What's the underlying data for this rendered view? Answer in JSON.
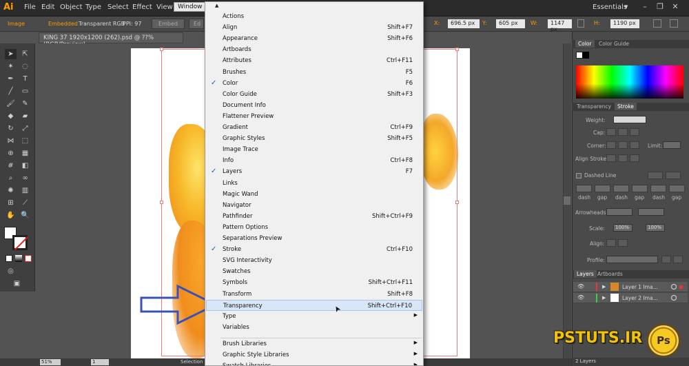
{
  "menubar": {
    "logo": "Ai",
    "items": [
      "File",
      "Edit",
      "Object",
      "Type",
      "Select",
      "Effect",
      "View",
      "Window"
    ],
    "workspace": "Essentials"
  },
  "controlbar": {
    "object_type": "Image",
    "embedded": "Embedded",
    "color_mode": "Transparent RGB",
    "ppi": "PPI: 97",
    "embed_button": "Embed",
    "edit_button": "Ed",
    "x_label": "X:",
    "x_value": "696.5 px",
    "y_label": "Y:",
    "y_value": "605 px",
    "w_label": "W:",
    "w_value": "1147 px",
    "h_label": "H:",
    "h_value": "1190 px"
  },
  "document": {
    "tab_title": "KING 37 1920x1200 (262).psd @ ??% (RGB/Preview)"
  },
  "statusbar": {
    "zoom": "51%",
    "page": "1",
    "tool_name": "Selection"
  },
  "window_menu": {
    "items": [
      {
        "label": "Actions",
        "shortcut": "",
        "checked": false,
        "submenu": false
      },
      {
        "label": "Align",
        "shortcut": "Shift+F7",
        "checked": false,
        "submenu": false
      },
      {
        "label": "Appearance",
        "shortcut": "Shift+F6",
        "checked": false,
        "submenu": false
      },
      {
        "label": "Artboards",
        "shortcut": "",
        "checked": false,
        "submenu": false
      },
      {
        "label": "Attributes",
        "shortcut": "Ctrl+F11",
        "checked": false,
        "submenu": false
      },
      {
        "label": "Brushes",
        "shortcut": "F5",
        "checked": false,
        "submenu": false
      },
      {
        "label": "Color",
        "shortcut": "F6",
        "checked": true,
        "submenu": false
      },
      {
        "label": "Color Guide",
        "shortcut": "Shift+F3",
        "checked": false,
        "submenu": false
      },
      {
        "label": "Document Info",
        "shortcut": "",
        "checked": false,
        "submenu": false
      },
      {
        "label": "Flattener Preview",
        "shortcut": "",
        "checked": false,
        "submenu": false
      },
      {
        "label": "Gradient",
        "shortcut": "Ctrl+F9",
        "checked": false,
        "submenu": false
      },
      {
        "label": "Graphic Styles",
        "shortcut": "Shift+F5",
        "checked": false,
        "submenu": false
      },
      {
        "label": "Image Trace",
        "shortcut": "",
        "checked": false,
        "submenu": false
      },
      {
        "label": "Info",
        "shortcut": "Ctrl+F8",
        "checked": false,
        "submenu": false
      },
      {
        "label": "Layers",
        "shortcut": "F7",
        "checked": true,
        "submenu": false
      },
      {
        "label": "Links",
        "shortcut": "",
        "checked": false,
        "submenu": false
      },
      {
        "label": "Magic Wand",
        "shortcut": "",
        "checked": false,
        "submenu": false
      },
      {
        "label": "Navigator",
        "shortcut": "",
        "checked": false,
        "submenu": false
      },
      {
        "label": "Pathfinder",
        "shortcut": "Shift+Ctrl+F9",
        "checked": false,
        "submenu": false
      },
      {
        "label": "Pattern Options",
        "shortcut": "",
        "checked": false,
        "submenu": false
      },
      {
        "label": "Separations Preview",
        "shortcut": "",
        "checked": false,
        "submenu": false
      },
      {
        "label": "Stroke",
        "shortcut": "Ctrl+F10",
        "checked": true,
        "submenu": false
      },
      {
        "label": "SVG Interactivity",
        "shortcut": "",
        "checked": false,
        "submenu": false
      },
      {
        "label": "Swatches",
        "shortcut": "",
        "checked": false,
        "submenu": false
      },
      {
        "label": "Symbols",
        "shortcut": "Shift+Ctrl+F11",
        "checked": false,
        "submenu": false
      },
      {
        "label": "Transform",
        "shortcut": "Shift+F8",
        "checked": false,
        "submenu": false
      },
      {
        "label": "Transparency",
        "shortcut": "Shift+Ctrl+F10",
        "checked": false,
        "submenu": false,
        "highlighted": true
      },
      {
        "label": "Type",
        "shortcut": "",
        "checked": false,
        "submenu": true
      },
      {
        "label": "Variables",
        "shortcut": "",
        "checked": false,
        "submenu": false
      },
      {
        "label": "Brush Libraries",
        "shortcut": "",
        "checked": false,
        "submenu": true,
        "separator_before": true
      },
      {
        "label": "Graphic Style Libraries",
        "shortcut": "",
        "checked": false,
        "submenu": true
      },
      {
        "label": "Swatch Libraries",
        "shortcut": "",
        "checked": false,
        "submenu": true
      }
    ]
  },
  "color_panel": {
    "tabs": [
      "Color",
      "Color Guide"
    ]
  },
  "stroke_panel": {
    "tabs": [
      "Transparency",
      "Stroke"
    ],
    "weight_label": "Weight:",
    "cap_label": "Cap:",
    "corner_label": "Corner:",
    "limit_label": "Limit:",
    "align_label": "Align Stroke:",
    "dashed_line_label": "Dashed Line",
    "dash_labels": [
      "dash",
      "gap",
      "dash",
      "gap",
      "dash",
      "gap"
    ],
    "arrowheads_label": "Arrowheads:",
    "scale_label": "Scale:",
    "scale_values": [
      "100%",
      "100%"
    ],
    "align_arrow_label": "Align:",
    "profile_label": "Profile:"
  },
  "layers_panel": {
    "tabs": [
      "Layers",
      "Artboards"
    ],
    "layers": [
      {
        "name": "Layer 1 Ima...",
        "color": "#e8343a"
      },
      {
        "name": "Layer 2 Ima...",
        "color": "#3ad14a"
      }
    ],
    "count": "2 Layers"
  },
  "watermark": {
    "text": "PSTUTS.IR",
    "badge": "Ps"
  },
  "colors": {
    "accent": "#ff9a00",
    "menu_highlight": "#d9e6f7",
    "arrow": "#3a52b8"
  }
}
